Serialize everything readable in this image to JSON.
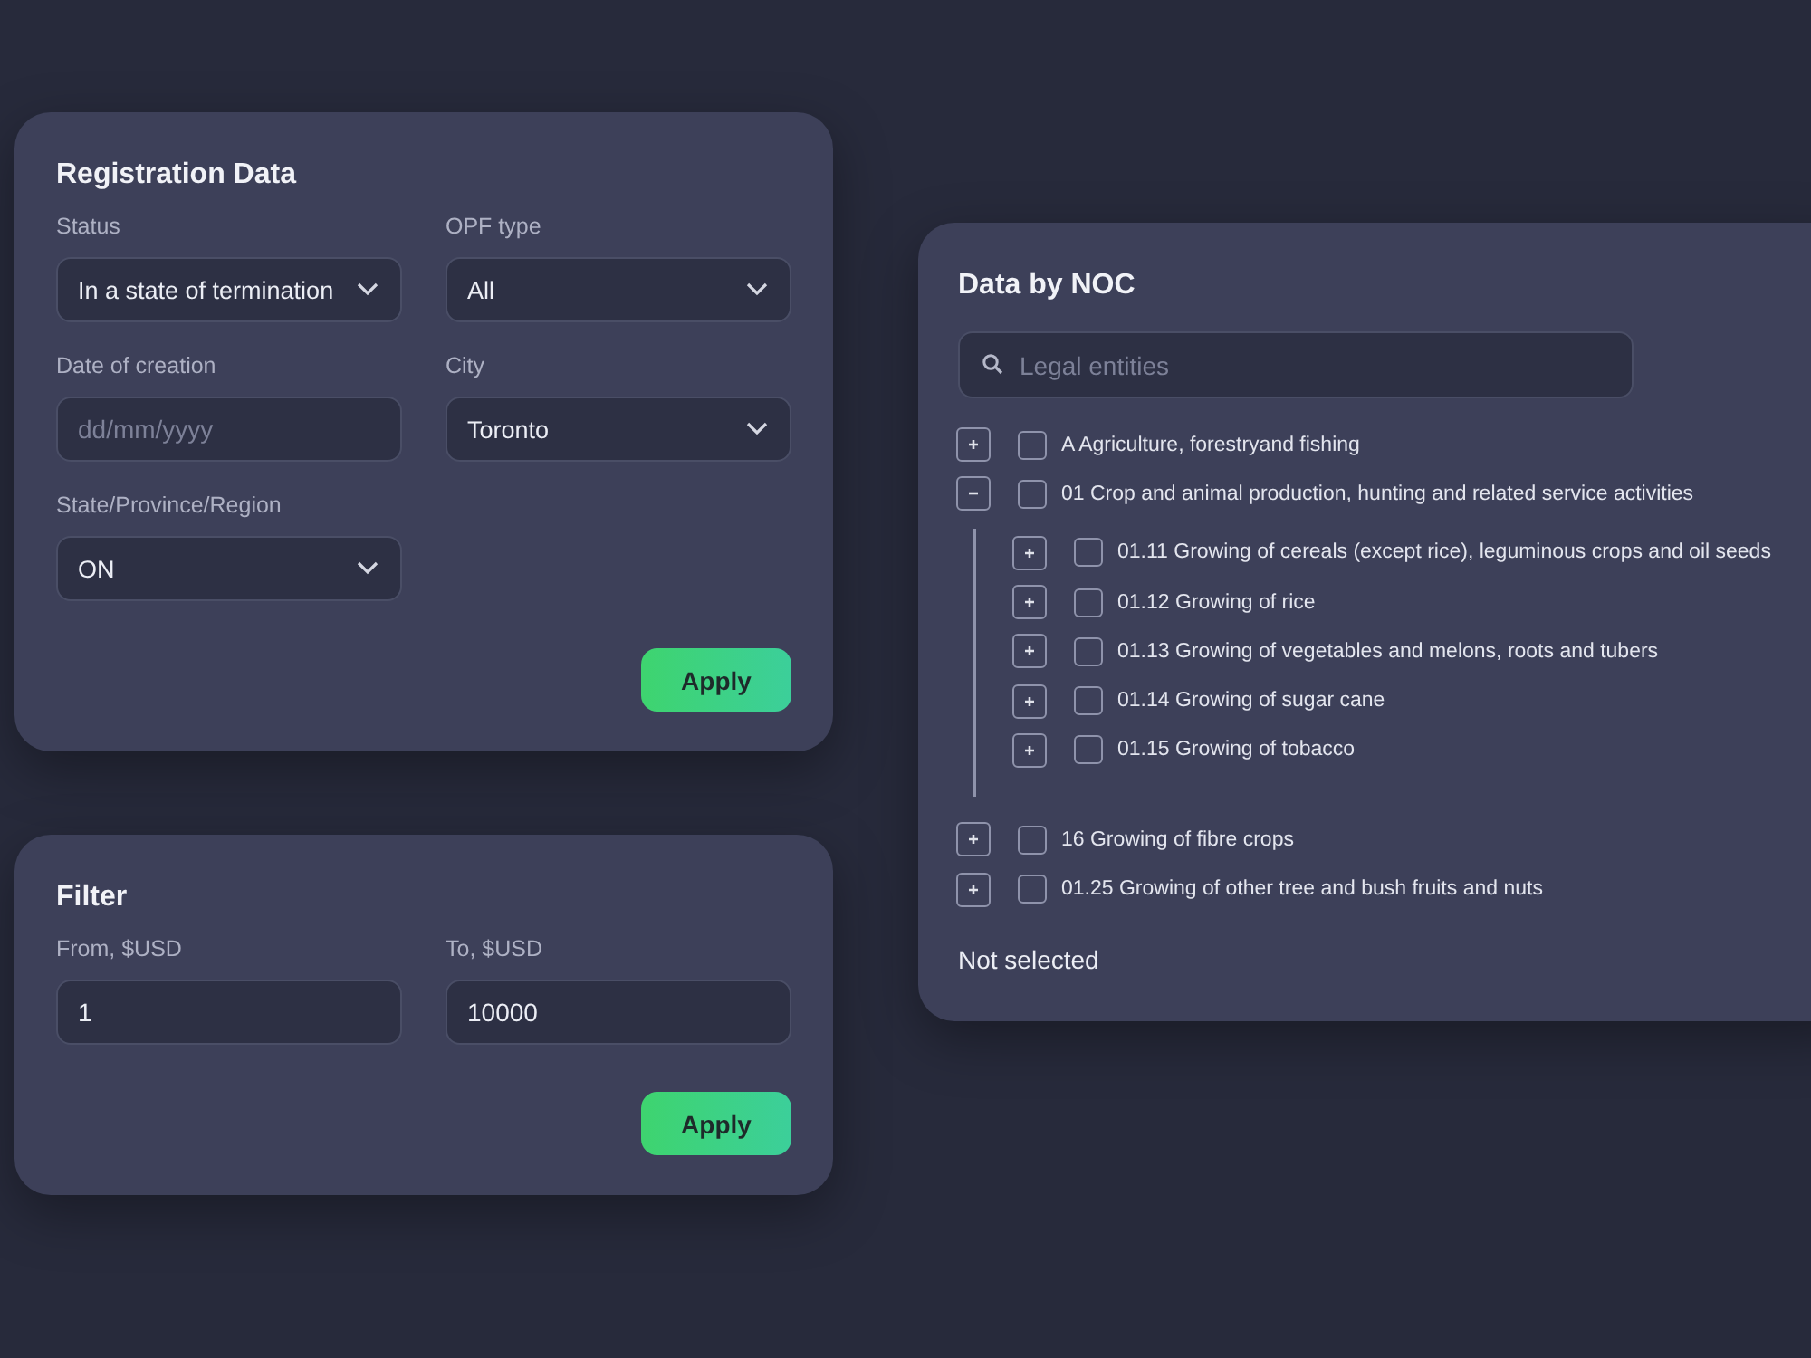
{
  "registration": {
    "title": "Registration Data",
    "fields": [
      {
        "label": "Status",
        "kind": "select",
        "value": "In a state of termination"
      },
      {
        "label": "OPF type",
        "kind": "select",
        "value": "All"
      },
      {
        "label": "Date of creation",
        "kind": "input",
        "placeholder": "dd/mm/yyyy"
      },
      {
        "label": "City",
        "kind": "select",
        "value": "Toronto"
      },
      {
        "label": "State/Province/Region",
        "kind": "select",
        "value": "ON"
      }
    ],
    "button": "Apply"
  },
  "filter": {
    "title": "Filter",
    "fields": [
      {
        "label": "From, $USD",
        "kind": "input",
        "value": "1"
      },
      {
        "label": "To, $USD",
        "kind": "input",
        "value": "10000"
      }
    ],
    "button": "Apply"
  },
  "noc": {
    "title": "Data by NOC",
    "search": {
      "placeholder": "Legal entities"
    },
    "tree": [
      {
        "label": "A Agriculture, forestryand fishing",
        "expanded": false,
        "checked": false
      },
      {
        "label": "01 Crop and animal production, hunting and related service activities",
        "expanded": true,
        "checked": false,
        "children": [
          {
            "label": "01.11 Growing of cereals (except rice), leguminous crops and oil seeds",
            "expanded": false,
            "checked": false
          },
          {
            "label": "01.12 Growing of rice",
            "expanded": false,
            "checked": false
          },
          {
            "label": "01.13 Growing of vegetables and melons, roots and tubers",
            "expanded": false,
            "checked": false
          },
          {
            "label": "01.14 Growing of sugar cane",
            "expanded": false,
            "checked": false
          },
          {
            "label": "01.15 Growing of tobacco",
            "expanded": false,
            "checked": false
          }
        ]
      },
      {
        "label": "16 Growing of fibre crops",
        "expanded": false,
        "checked": false
      },
      {
        "label": "01.25 Growing of other tree and bush fruits and nuts",
        "expanded": false,
        "checked": false
      }
    ],
    "status": "Not selected"
  }
}
